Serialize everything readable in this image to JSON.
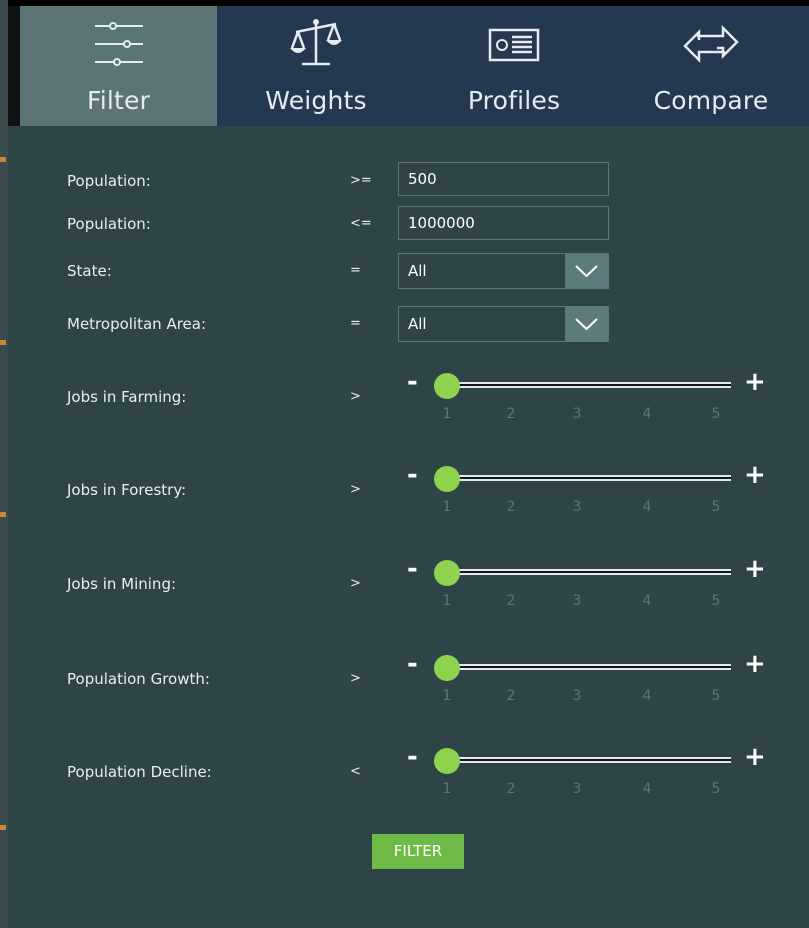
{
  "tabs": [
    {
      "id": "filter",
      "label": "Filter",
      "icon": "sliders-icon",
      "active": true
    },
    {
      "id": "weights",
      "label": "Weights",
      "icon": "scale-icon",
      "active": false
    },
    {
      "id": "profiles",
      "label": "Profiles",
      "icon": "profile-card-icon",
      "active": false
    },
    {
      "id": "compare",
      "label": "Compare",
      "icon": "swap-arrows-icon",
      "active": false
    }
  ],
  "filters": {
    "population_min": {
      "label": "Population:",
      "operator": ">=",
      "value": "500"
    },
    "population_max": {
      "label": "Population:",
      "operator": "<=",
      "value": "1000000"
    },
    "state": {
      "label": "State:",
      "operator": "=",
      "value": "All",
      "arrow_icon": "chevron-down-icon"
    },
    "metro": {
      "label": "Metropolitan Area:",
      "operator": "=",
      "value": "All",
      "arrow_icon": "chevron-down-icon"
    }
  },
  "sliders": [
    {
      "label": "Jobs in Farming:",
      "operator": ">",
      "value": 1
    },
    {
      "label": "Jobs in Forestry:",
      "operator": ">",
      "value": 1
    },
    {
      "label": "Jobs in Mining:",
      "operator": ">",
      "value": 1
    },
    {
      "label": "Population Growth:",
      "operator": ">",
      "value": 1
    },
    {
      "label": "Population Decline:",
      "operator": "<",
      "value": 1
    }
  ],
  "slider_scale": {
    "ticks": [
      "1",
      "2",
      "3",
      "4",
      "5"
    ],
    "minus": "-",
    "plus": "+"
  },
  "filter_button": {
    "label": "FILTER"
  },
  "colors": {
    "panel_bg": "#2f4447",
    "tabbar_bg": "#24384f",
    "tab_active_bg": "#5b7476",
    "accent_green": "#6dbb46",
    "thumb_green": "#8ed24e",
    "select_arrow_bg": "#5d7b7d"
  }
}
